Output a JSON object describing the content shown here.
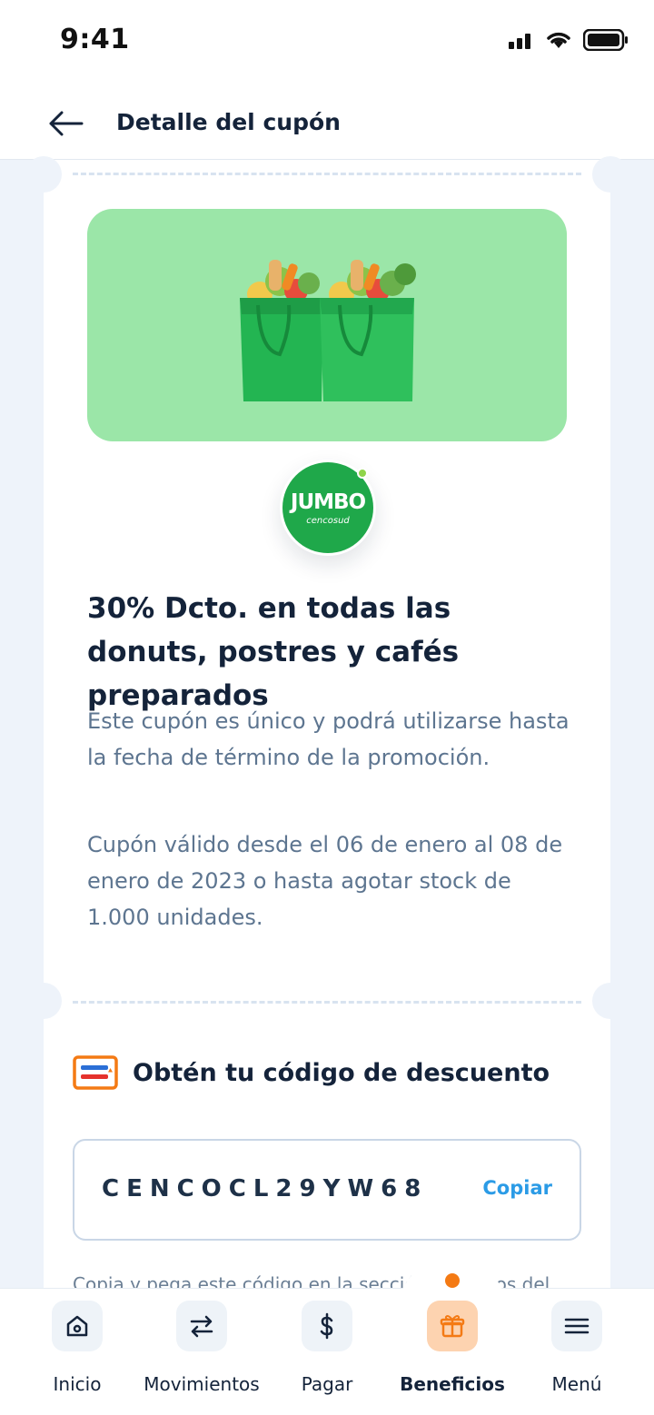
{
  "status_bar": {
    "time": "9:41"
  },
  "header": {
    "title": "Detalle del cupón"
  },
  "coupon": {
    "brand": {
      "name": "JUMBO",
      "sub": "cencosud"
    },
    "title": "30% Dcto. en todas las donuts, postres y cafés preparados",
    "description": "Este cupón es único y podrá utilizarse hasta la fecha de término de la promoción.",
    "validity": "Cupón válido desde el 06 de enero al 08 de enero de 2023 o hasta agotar stock de 1.000 unidades."
  },
  "code_section": {
    "heading": "Obtén tu código de descuento",
    "code": "CENCOCL29YW68",
    "copy_label": "Copiar",
    "hint": "Copia y pega este código en la sección de pagos del"
  },
  "bottom_nav": {
    "items": [
      {
        "label": "Inicio",
        "icon": "home-icon"
      },
      {
        "label": "Movimientos",
        "icon": "transfer-arrows-icon"
      },
      {
        "label": "Pagar",
        "icon": "dollar-icon"
      },
      {
        "label": "Beneficios",
        "icon": "gift-icon",
        "active": true
      },
      {
        "label": "Menú",
        "icon": "hamburger-menu-icon"
      }
    ]
  },
  "colors": {
    "accent_orange": "#f47a14",
    "link_blue": "#2b9be6",
    "brand_green": "#1fa84a",
    "hero_green": "#9be6a8"
  }
}
